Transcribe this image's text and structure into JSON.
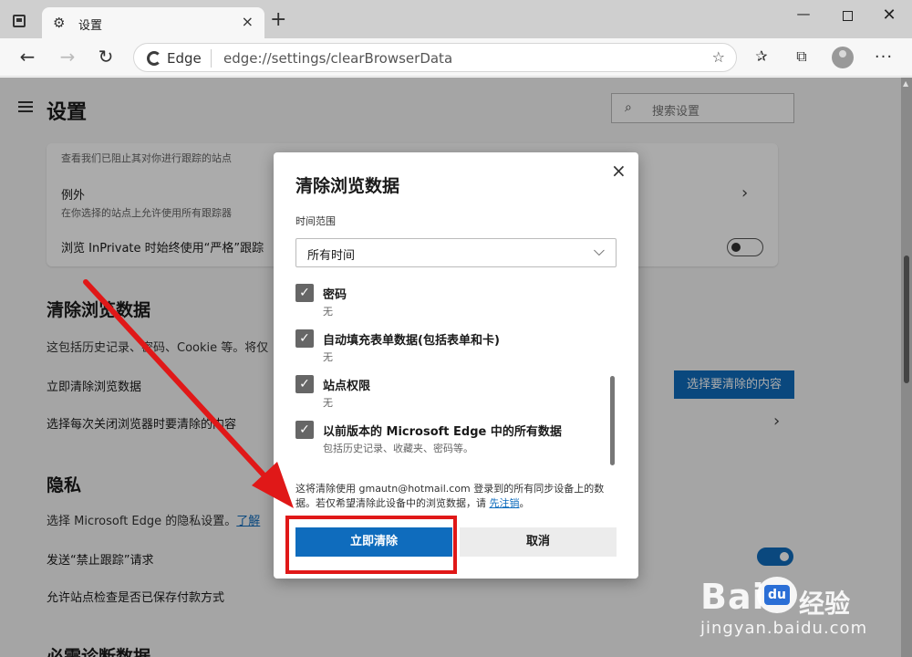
{
  "browser": {
    "tab_title": "设置",
    "new_tab_icon": "+",
    "url_label": "Edge",
    "url": "edge://settings/clearBrowserData"
  },
  "settings": {
    "title": "设置",
    "search_placeholder": "搜索设置",
    "card": {
      "sub1": "查看我们已阻止其对你进行跟踪的站点",
      "exceptions_title": "例外",
      "exceptions_sub": "在你选择的站点上允许使用所有跟踪器",
      "inprivate_label": "浏览 InPrivate 时始终使用“严格”跟踪"
    },
    "clear_section": {
      "heading": "清除浏览数据",
      "desc": "这包括历史记录、密码、Cookie 等。将仅",
      "row1": "立即清除浏览数据",
      "row1_button": "选择要清除的内容",
      "row2": "选择每次关闭浏览器时要清除的内容"
    },
    "privacy_section": {
      "heading": "隐私",
      "desc": "选择 Microsoft Edge 的隐私设置。",
      "desc_link": "了解",
      "row1": "发送“禁止跟踪”请求",
      "row2": "允许站点检查是否已保存付款方式"
    },
    "next_heading": "必需诊断数据"
  },
  "dialog": {
    "title": "清除浏览数据",
    "close_icon": "×",
    "time_range_label": "时间范围",
    "time_range_value": "所有时间",
    "options": [
      {
        "title": "密码",
        "sub": "无",
        "checked": true
      },
      {
        "title": "自动填充表单数据(包括表单和卡)",
        "sub": "无",
        "checked": true
      },
      {
        "title": "站点权限",
        "sub": "无",
        "checked": true
      },
      {
        "title": "以前版本的 Microsoft Edge 中的所有数据",
        "sub": "包括历史记录、收藏夹、密码等。",
        "checked": true
      }
    ],
    "info_text": "这将清除使用 gmautn@hotmail.com 登录到的所有同步设备上的数据。若仅希望清除此设备中的浏览数据，请 ",
    "info_link": "先注销",
    "info_end": "。",
    "clear_button": "立即清除",
    "cancel_button": "取消"
  },
  "watermark": {
    "logo": "Bai",
    "du": "du",
    "cn": "经验",
    "url": "jingyan.baidu.com"
  },
  "colors": {
    "accent": "#0f6cbd",
    "annotation": "#e01818"
  }
}
